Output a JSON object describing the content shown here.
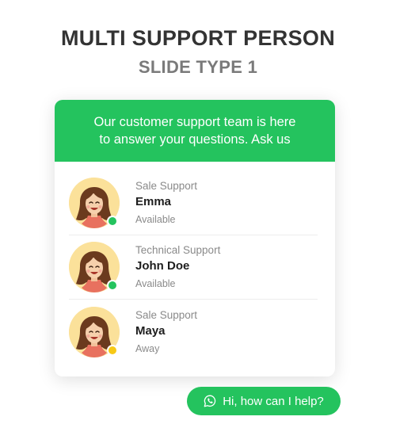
{
  "title": "MULTI SUPPORT PERSON",
  "subtitle": "SLIDE TYPE 1",
  "widget": {
    "header_line1": "Our customer support team is here",
    "header_line2": "to answer your questions. Ask us",
    "agents": [
      {
        "role": "Sale Support",
        "name": "Emma",
        "status": "Available",
        "status_color": "#24c35e"
      },
      {
        "role": "Technical Support",
        "name": "John Doe",
        "status": "Available",
        "status_color": "#24c35e"
      },
      {
        "role": "Sale Support",
        "name": "Maya",
        "status": "Away",
        "status_color": "#f7c916"
      }
    ]
  },
  "help_button": {
    "label": "Hi, how can I help?",
    "icon": "whatsapp-icon"
  },
  "colors": {
    "accent": "#24c35e",
    "away": "#f7c916",
    "avatar_bg": "#fbe19a"
  }
}
